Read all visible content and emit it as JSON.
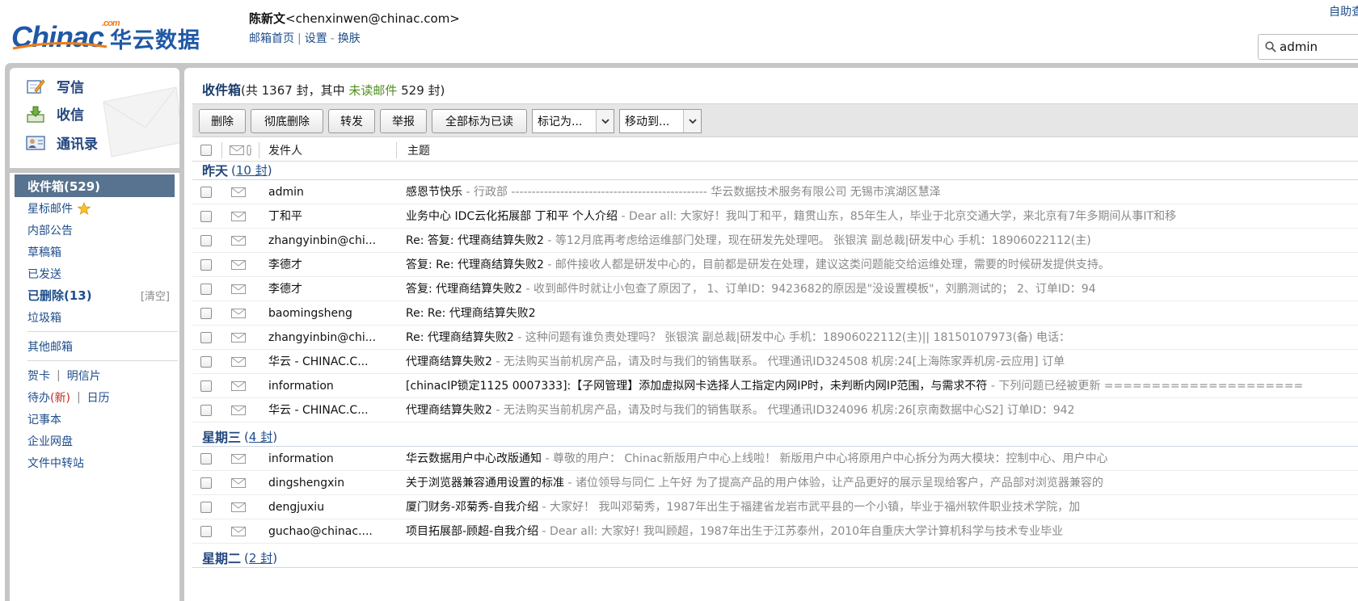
{
  "header": {
    "logo_brand": "Chinac",
    "logo_com": ".com",
    "logo_cn": "华云数据",
    "user_name": "陈新文",
    "user_email": "<chenxinwen@chinac.com>",
    "links": [
      "邮箱首页",
      "设置",
      "换肤"
    ],
    "top_right_link": "自助查询",
    "search_value": "admin"
  },
  "sidebar": {
    "actions": [
      {
        "label": "写信",
        "icon": "compose-icon"
      },
      {
        "label": "收信",
        "icon": "receive-icon"
      },
      {
        "label": "通讯录",
        "icon": "contacts-icon"
      }
    ],
    "folders": {
      "inbox": "收件箱(529)",
      "starred": "星标邮件",
      "internal": "内部公告",
      "drafts": "草稿箱",
      "sent": "已发送",
      "deleted": "已删除(13)",
      "deleted_clear": "[清空]",
      "spam": "垃圾箱",
      "other": "其他邮箱",
      "greeting_card": "贺卡",
      "postcard": "明信片",
      "todo": "待办",
      "todo_new": "(新)",
      "calendar": "日历",
      "notes": "记事本",
      "netdisk": "企业网盘",
      "transfer": "文件中转站"
    }
  },
  "main": {
    "title": "收件箱",
    "summary_prefix": "(共 1367 封，其中 ",
    "summary_unread": "未读邮件",
    "summary_suffix": " 529 封)",
    "toolbar": {
      "delete": "删除",
      "delete_perm": "彻底删除",
      "forward": "转发",
      "report": "举报",
      "mark_all_read": "全部标为已读",
      "mark_as": "标记为...",
      "move_to": "移动到..."
    },
    "columns": {
      "sender": "发件人",
      "subject": "主题"
    },
    "groups": [
      {
        "label": "昨天",
        "count": "10 封",
        "emails": [
          {
            "from": "admin",
            "subject": "感恩节快乐",
            "preview": " - 行政部  ------------------------------------------------ 华云数据技术服务有限公司 无锡市滨湖区慧泽"
          },
          {
            "from": "丁和平",
            "subject": "业务中心 IDC云化拓展部 丁和平 个人介绍",
            "preview": " - Dear all:  大家好！我叫丁和平，籍贯山东，85年生人，毕业于北京交通大学，来北京有7年多期间从事IT和移"
          },
          {
            "from": "zhangyinbin@chi...",
            "subject": "Re: 答复: 代理商结算失败2",
            "preview": " -   等12月底再考虑给运维部门处理，现在研发先处理吧。    张银滨  副总裁|研发中心 手机：18906022112(主)"
          },
          {
            "from": "李德才",
            "subject": "答复: Re: 代理商结算失败2",
            "preview": " - 邮件接收人都是研发中心的，目前都是研发在处理，建议这类问题能交给运维处理，需要的时候研发提供支持。"
          },
          {
            "from": "李德才",
            "subject": "答复: 代理商结算失败2",
            "preview": " - 收到邮件时就让小包查了原因了， 1、订单ID：9423682的原因是\"没设置模板\"，刘鹏测试的； 2、订单ID：94"
          },
          {
            "from": "baomingsheng",
            "subject": "Re: Re: 代理商结算失败2",
            "preview": ""
          },
          {
            "from": "zhangyinbin@chi...",
            "subject": "Re: 代理商结算失败2",
            "preview": " -  这种问题有谁负责处理吗？   张银滨  副总裁|研发中心 手机：18906022112(主)|| 18150107973(备)  电话："
          },
          {
            "from": "华云 - CHINAC.C...",
            "subject": "代理商结算失败2",
            "preview": " - 无法购买当前机房产品，请及时与我们的销售联系。 代理通讯ID324508 机房:24[上海陈家弄机房-云应用] 订单"
          },
          {
            "from": "information",
            "subject": "[chinacIP锁定1125 0007333]:【子网管理】添加虚拟网卡选择人工指定内网IP时，未判断内网IP范围，与需求不符",
            "preview": " - 下列问题已经被更新 ====================="
          },
          {
            "from": "华云 - CHINAC.C...",
            "subject": "代理商结算失败2",
            "preview": " - 无法购买当前机房产品，请及时与我们的销售联系。 代理通讯ID324096 机房:26[京南数据中心S2] 订单ID：942"
          }
        ]
      },
      {
        "label": "星期三",
        "count": "4 封",
        "emails": [
          {
            "from": "information",
            "subject": "华云数据用户中心改版通知",
            "preview": " - 尊敬的用户：  Chinac新版用户中心上线啦！ 新版用户中心将原用户中心拆分为两大模块：控制中心、用户中心"
          },
          {
            "from": "dingshengxin",
            "subject": "关于浏览器兼容通用设置的标准",
            "preview": " - 诸位领导与同仁   上午好   为了提高产品的用户体验，让产品更好的展示呈现给客户，产品部对浏览器兼容的"
          },
          {
            "from": "dengjuxiu",
            "subject": "厦门财务-邓菊秀-自我介绍",
            "preview": " - 大家好！     我叫邓菊秀，1987年出生于福建省龙岩市武平县的一个小镇，毕业于福州软件职业技术学院，加"
          },
          {
            "from": "guchao@chinac....",
            "subject": "项目拓展部-顾超-自我介绍",
            "preview": " -  Dear all:      大家好!     我叫顾超，1987年出生于江苏泰州，2010年自重庆大学计算机科学与技术专业毕业"
          }
        ]
      },
      {
        "label": "星期二",
        "count": "2 封",
        "emails": []
      }
    ]
  },
  "colors": {
    "brand_blue": "#1f58a6",
    "brand_orange": "#ef7d16",
    "active_folder": "#57738f",
    "unread_green": "#4e8f1e"
  }
}
